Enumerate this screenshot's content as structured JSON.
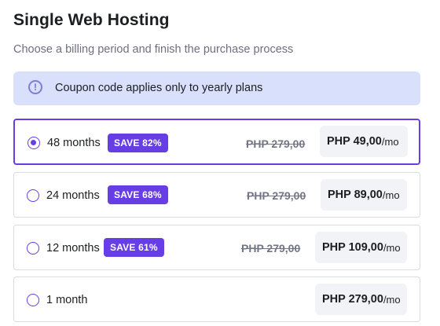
{
  "page": {
    "title": "Single Web Hosting",
    "subtitle": "Choose a billing period and finish the purchase process"
  },
  "notice": {
    "icon": "info-icon",
    "icon_glyph": "!",
    "text": "Coupon code applies only to yearly plans"
  },
  "colors": {
    "accent": "#673de6",
    "notice_bg": "#d9e0fc",
    "price_box_bg": "#f2f3f6"
  },
  "plans": [
    {
      "period": "48 months",
      "badge": "SAVE 82%",
      "old_price": "PHP 279,00",
      "price": "PHP 49,00",
      "unit": "/mo",
      "selected": true
    },
    {
      "period": "24 months",
      "badge": "SAVE 68%",
      "old_price": "PHP 279,00",
      "price": "PHP 89,00",
      "unit": "/mo",
      "selected": false
    },
    {
      "period": "12 months",
      "badge": "SAVE 61%",
      "old_price": "PHP 279,00",
      "price": "PHP 109,00",
      "unit": "/mo",
      "selected": false
    },
    {
      "period": "1 month",
      "badge": "",
      "old_price": "",
      "price": "PHP 279,00",
      "unit": "/mo",
      "selected": false
    }
  ]
}
